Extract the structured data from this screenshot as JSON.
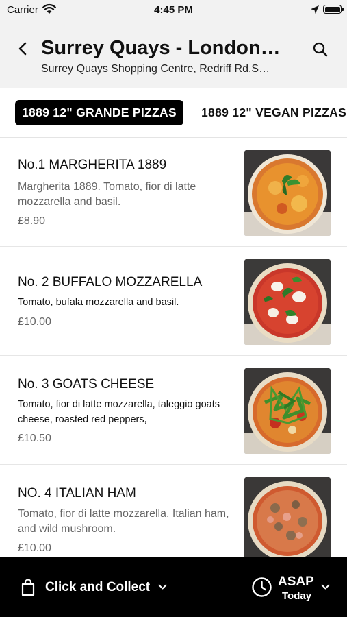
{
  "status_bar": {
    "carrier": "Carrier",
    "time": "4:45 PM"
  },
  "header": {
    "title": "Surrey Quays - London…",
    "subtitle": "Surrey Quays Shopping Centre, Redriff Rd,S…",
    "back_icon": "chevron-left-icon",
    "search_icon": "search-icon"
  },
  "category_tabs": [
    {
      "label": "1889 12\" GRANDE PIZZAS",
      "active": true
    },
    {
      "label": "1889 12\" VEGAN PIZZAS",
      "active": false
    }
  ],
  "menu_items": [
    {
      "name": "No.1 MARGHERITA 1889",
      "description": "Margherita 1889. Tomato, fior di latte mozzarella and basil.",
      "price": "£8.90"
    },
    {
      "name": "No. 2 BUFFALO MOZZARELLA",
      "description": "Tomato, bufala mozzarella and basil.",
      "price": "£10.00"
    },
    {
      "name": "No. 3 GOATS CHEESE",
      "description": "Tomato, fior di latte mozzarella, taleggio goats cheese, roasted red peppers,",
      "price": "£10.50"
    },
    {
      "name": "NO. 4 ITALIAN HAM",
      "description": "Tomato, fior di latte mozzarella, Italian ham, and wild mushroom.",
      "price": "£10.00"
    }
  ],
  "bottom_bar": {
    "order_mode": "Click and Collect",
    "time_main": "ASAP",
    "time_sub": "Today",
    "bag_icon": "shopping-bag-icon",
    "clock_icon": "clock-icon"
  },
  "colors": {
    "header_bg": "#f2f2f2",
    "active_tab_bg": "#000000",
    "bottom_bar_bg": "#000000",
    "secondary_text": "#666666"
  }
}
